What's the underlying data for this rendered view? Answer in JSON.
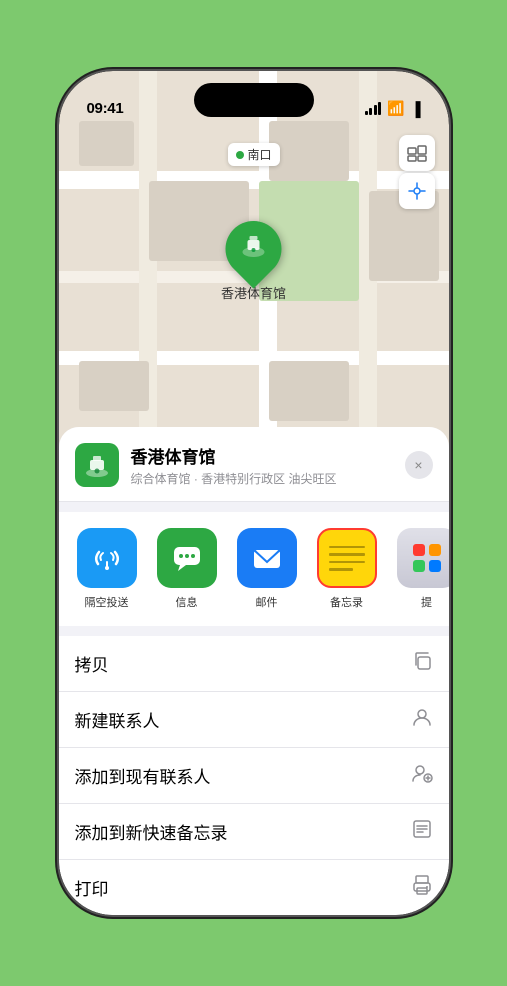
{
  "phone": {
    "status_bar": {
      "time": "09:41",
      "location_arrow": "▶"
    },
    "map": {
      "location_label": "南口",
      "venue_pin_label": "香港体育馆"
    },
    "sheet": {
      "venue_name": "香港体育馆",
      "venue_sub": "综合体育馆 · 香港特别行政区 油尖旺区",
      "close_label": "×",
      "apps": [
        {
          "id": "airdrop",
          "label": "隔空投送",
          "emoji": "📡"
        },
        {
          "id": "messages",
          "label": "信息",
          "emoji": "💬"
        },
        {
          "id": "mail",
          "label": "邮件",
          "emoji": "✉️"
        },
        {
          "id": "notes",
          "label": "备忘录",
          "emoji": ""
        },
        {
          "id": "more",
          "label": "提",
          "emoji": ""
        }
      ],
      "actions": [
        {
          "id": "copy",
          "label": "拷贝",
          "icon": "⎘"
        },
        {
          "id": "new-contact",
          "label": "新建联系人",
          "icon": "👤"
        },
        {
          "id": "add-contact",
          "label": "添加到现有联系人",
          "icon": "👤+"
        },
        {
          "id": "quick-notes",
          "label": "添加到新快速备忘录",
          "icon": "🗒️"
        },
        {
          "id": "print",
          "label": "打印",
          "icon": "🖨️"
        }
      ]
    }
  }
}
